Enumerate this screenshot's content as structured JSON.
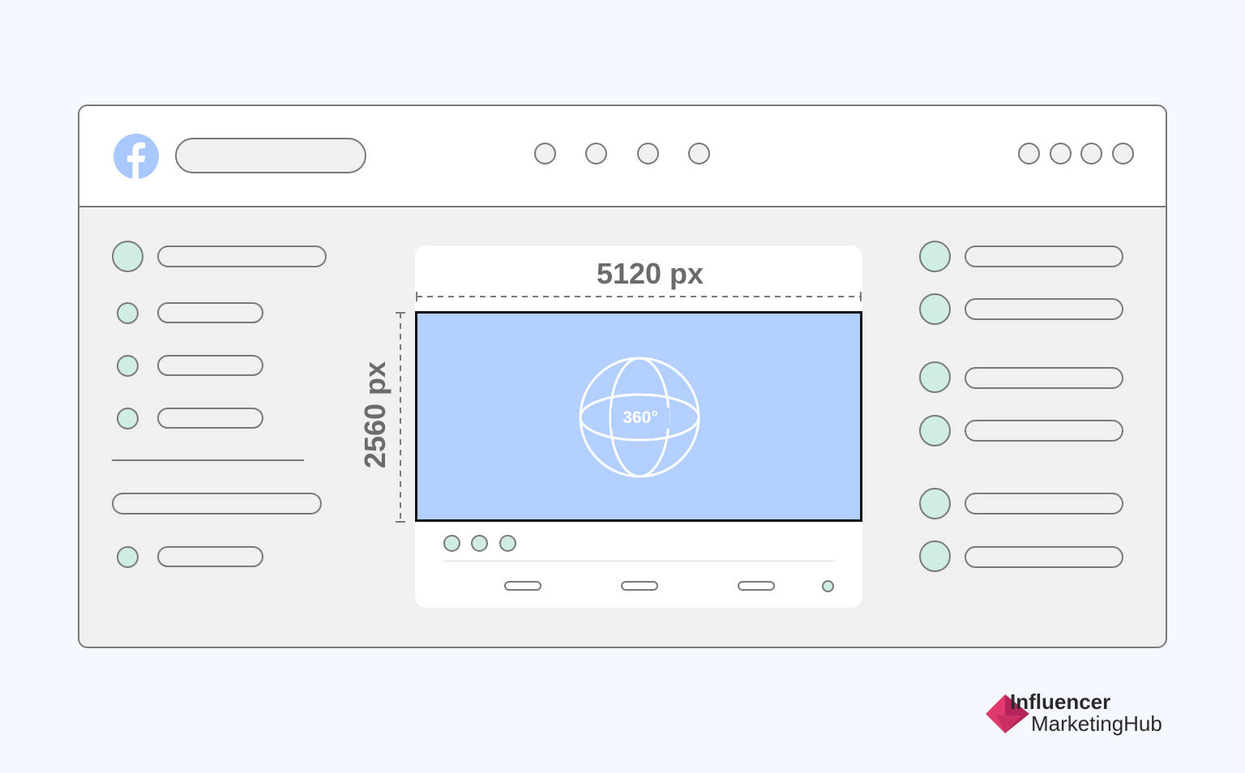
{
  "header": {
    "logo_icon": "facebook-logo-icon",
    "search_bar_icon": "search-bar",
    "nav_dots": 4,
    "action_dots": 4
  },
  "media": {
    "width_label": "5120 px",
    "height_label": "2560 px",
    "badge": "360°",
    "icon": "globe-360-icon"
  },
  "brand": {
    "line1": "Influencer",
    "line2": "MarketingHub"
  },
  "colors": {
    "background": "#f5f8fe",
    "media_fill": "#b3cffe",
    "accent_mint": "#d0ede2",
    "facebook_blue": "#a9c8fd",
    "brand_pink": "#e03a6c"
  }
}
